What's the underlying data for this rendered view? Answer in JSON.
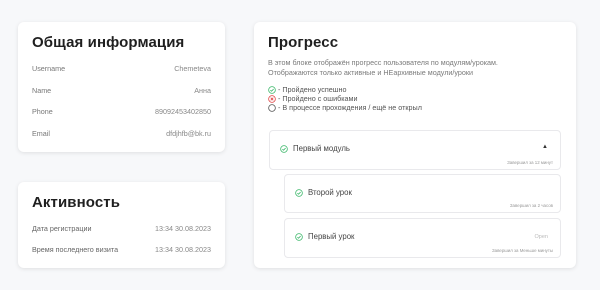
{
  "general": {
    "title": "Общая информация",
    "rows": [
      {
        "label": "Username",
        "value": "Chemeteva"
      },
      {
        "label": "Name",
        "value": "Анна"
      },
      {
        "label": "Phone",
        "value": "89092453402850"
      },
      {
        "label": "Email",
        "value": "dfdjhfb@bk.ru"
      }
    ]
  },
  "activity": {
    "title": "Активность",
    "rows": [
      {
        "label": "Дата регистрации",
        "value": "13:34 30.08.2023"
      },
      {
        "label": "Время последнего визита",
        "value": "13:34 30.08.2023"
      }
    ]
  },
  "progress": {
    "title": "Прогресс",
    "description_line1": "В этом блоке отображён прогресс пользователя по модулям/урокам.",
    "description_line2": "Отображаются только активные и НЕархивные модули/уроки",
    "legend": {
      "success": "- Пройдено успешно",
      "errors": "- Пройдено с ошибками",
      "in_progress": "- В процессе прохождения / ещё не открыл"
    },
    "colors": {
      "success": "#3db86b",
      "error": "#e04545",
      "neutral": "#555555"
    },
    "module": {
      "title": "Первый модуль",
      "note": "Завершил за 12 минут",
      "caret": "▲"
    },
    "lessons": [
      {
        "title": "Второй урок",
        "note": "Завершил за 2 часов",
        "status": ""
      },
      {
        "title": "Первый урок",
        "note": "Завершил за Меньше минуты",
        "status": "Open"
      }
    ]
  }
}
